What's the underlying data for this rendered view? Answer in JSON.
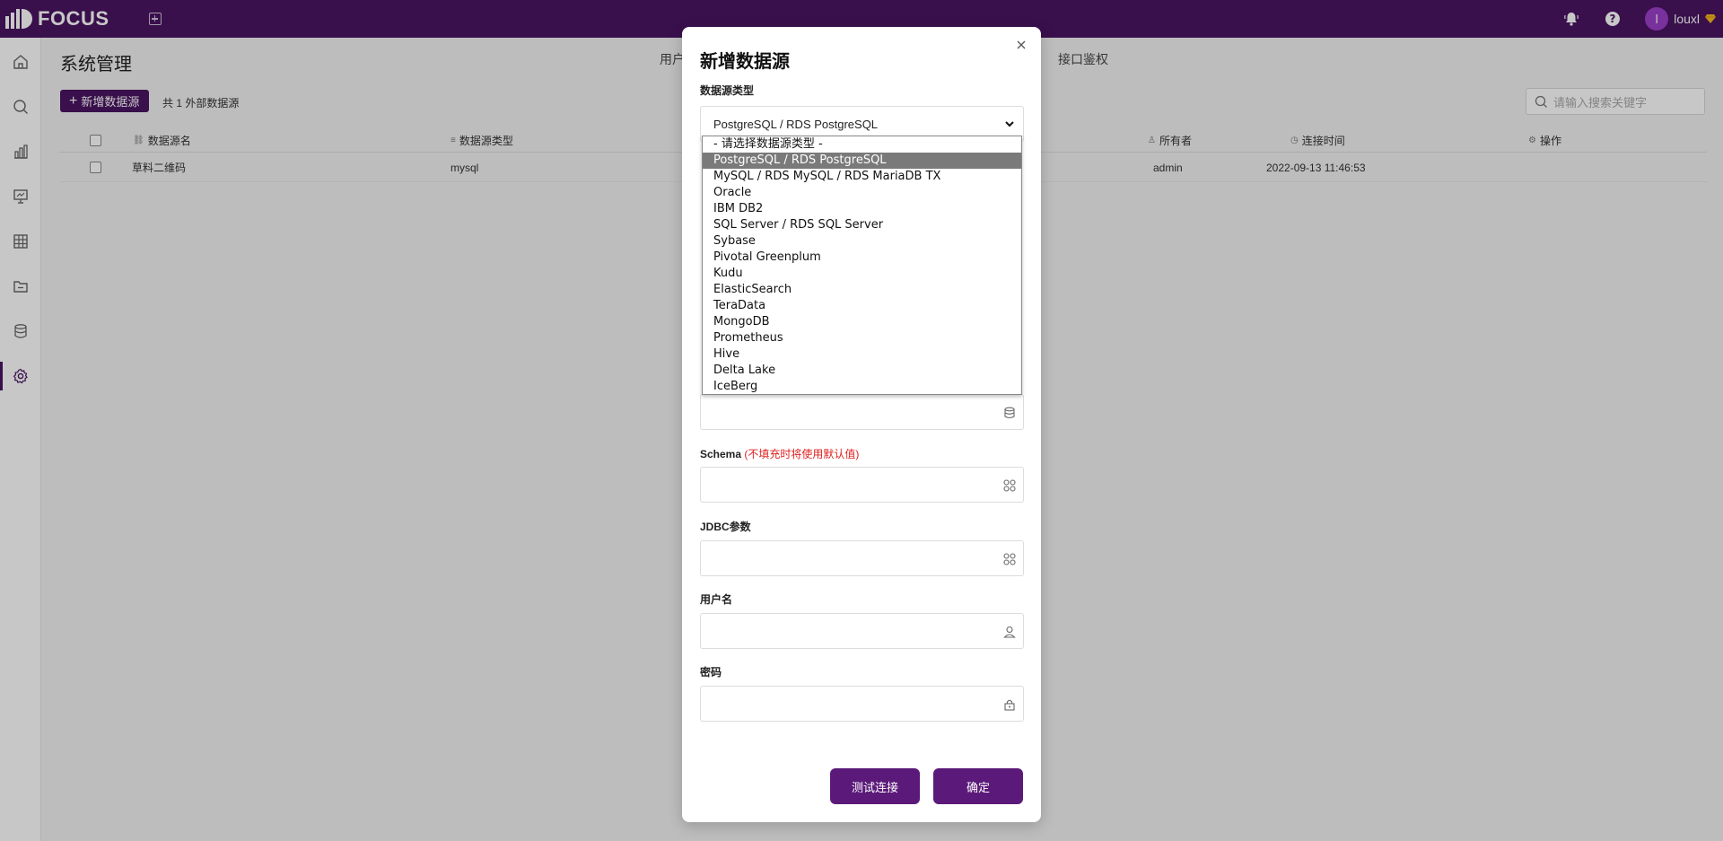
{
  "app": {
    "logo_text": "FOCUS"
  },
  "topbar": {
    "user_initial": "l",
    "username": "louxl"
  },
  "page": {
    "title": "系统管理",
    "tabs": [
      "用户",
      "接口鉴权"
    ],
    "add_button": "新增数据源",
    "count_text": "共 1 外部数据源",
    "search_placeholder": "请输入搜索关键字"
  },
  "table": {
    "headers": {
      "name": "数据源名",
      "type": "数据源类型",
      "owner": "所有者",
      "time": "连接时间",
      "action": "操作"
    },
    "rows": [
      {
        "name": "草料二维码",
        "type": "mysql",
        "owner": "admin",
        "time": "2022-09-13 11:46:53"
      }
    ]
  },
  "modal": {
    "title": "新增数据源",
    "type_label": "数据源类型",
    "selected_type": "PostgreSQL / RDS PostgreSQL",
    "schema_label": "Schema",
    "schema_hint": "(不填充时将使用默认值)",
    "jdbc_label": "JDBC参数",
    "username_label": "用户名",
    "password_label": "密码",
    "test_button": "测试连接",
    "ok_button": "确定"
  },
  "dropdown": {
    "options": [
      "- 请选择数据源类型 -",
      "PostgreSQL / RDS PostgreSQL",
      "MySQL / RDS MySQL / RDS MariaDB TX",
      "Oracle",
      "IBM DB2",
      "SQL Server / RDS SQL Server",
      "Sybase",
      "Pivotal Greenplum",
      "Kudu",
      "ElasticSearch",
      "TeraData",
      "MongoDB",
      "Prometheus",
      "Hive",
      "Delta Lake",
      "IceBerg"
    ],
    "selected_index": 1
  },
  "colors": {
    "brand": "#4a1462",
    "button": "#5b1a79",
    "hint": "#e02020"
  }
}
